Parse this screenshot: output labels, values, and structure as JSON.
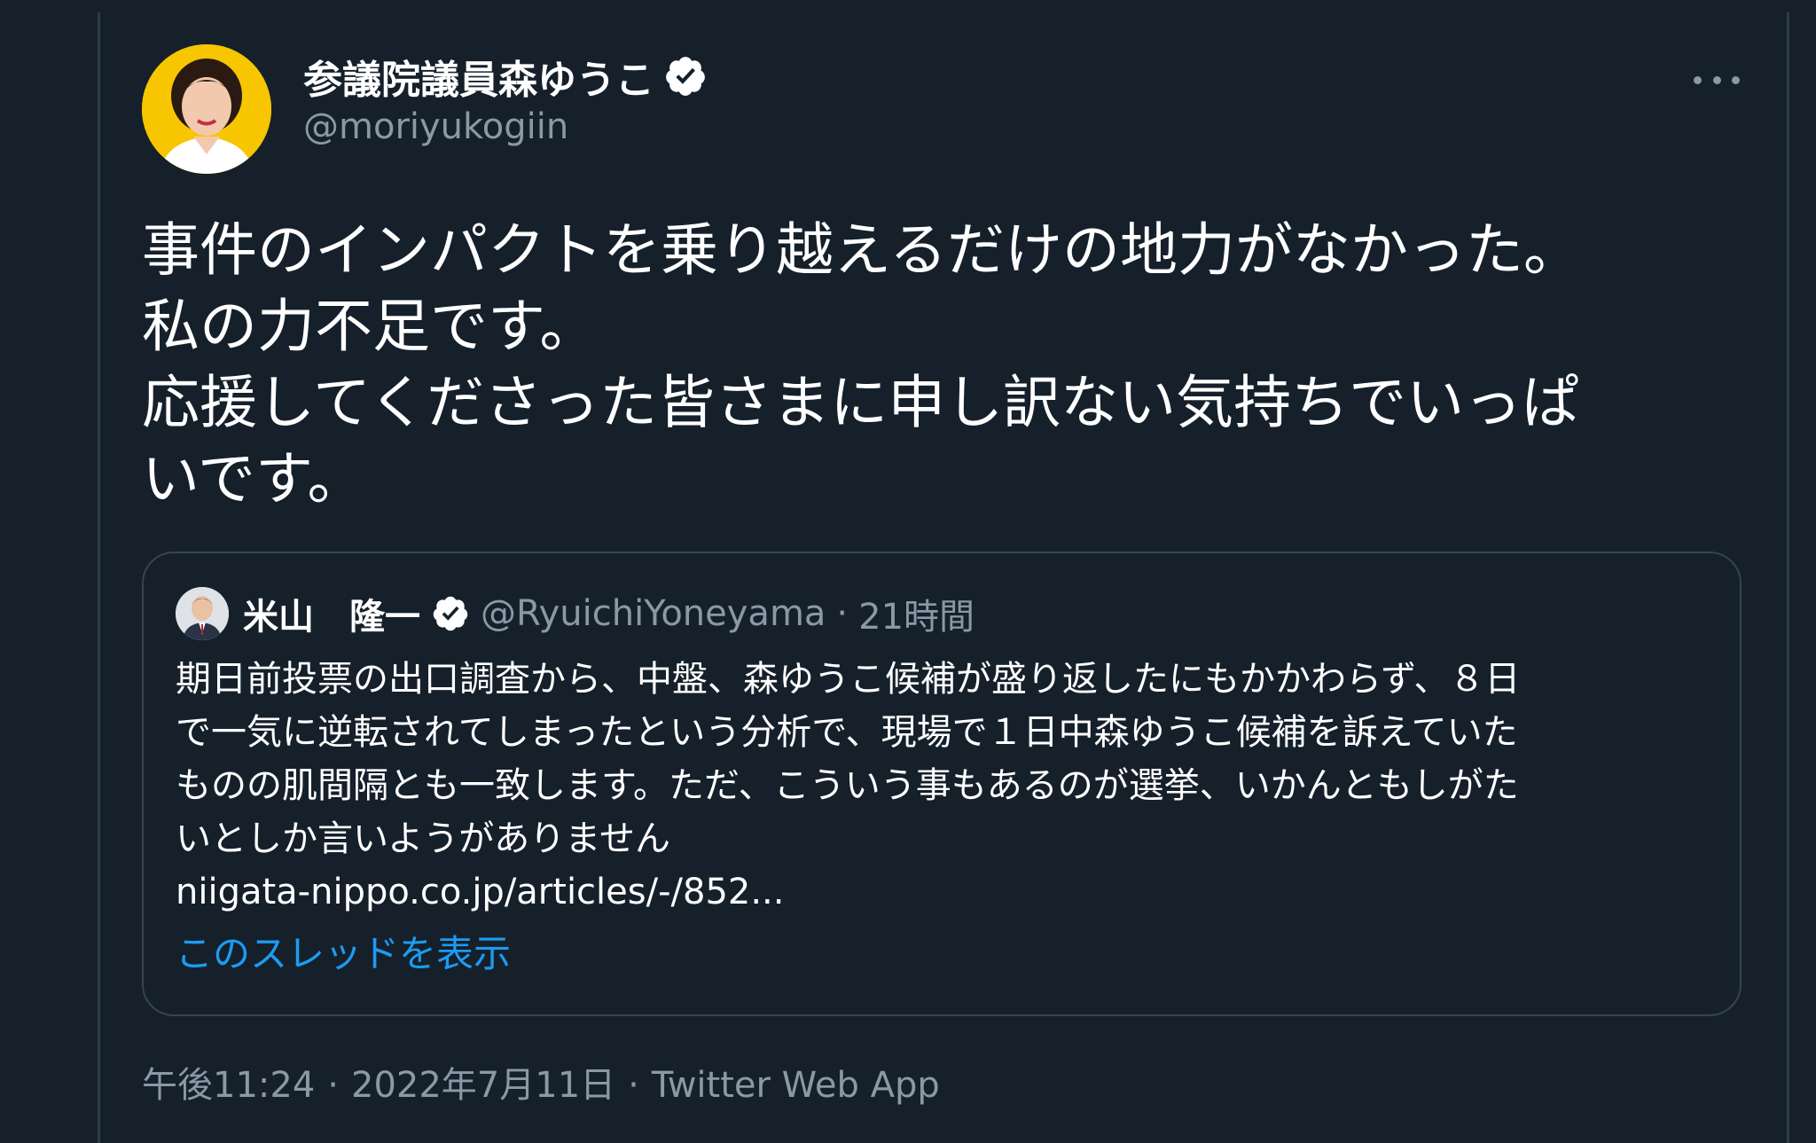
{
  "tweet": {
    "display_name": "参議院議員森ゆうこ",
    "handle": "@moriyukogiin",
    "body_lines": [
      "事件のインパクトを乗り越えるだけの地力がなかった。",
      "私の力不足です。",
      "応援してくださった皆さまに申し訳ない気持ちでいっぱ",
      "いです。"
    ],
    "time": "午後11:24",
    "date": "2022年7月11日",
    "client": "Twitter Web App",
    "separator": "·"
  },
  "quote": {
    "display_name": "米山　隆一",
    "handle": "@RyuichiYoneyama",
    "separator": "·",
    "time_ago": "21時間",
    "text_lines": [
      "期日前投票の出口調査から、中盤、森ゆうこ候補が盛り返したにもかかわらず、８日",
      "で一気に逆転されてしまったという分析で、現場で１日中森ゆうこ候補を訴えていた",
      "ものの肌間隔とも一致します。ただ、こういう事もあるのが選挙、いかんともしがた",
      "いとしか言いようがありません"
    ],
    "link": "niigata-nippo.co.jp/articles/-/852...",
    "show_thread": "このスレッドを表示"
  },
  "icons": {
    "verified": "verified-badge-icon",
    "more": "more-options-icon"
  },
  "colors": {
    "background": "#15202b",
    "accent": "#1d9bf0",
    "secondary_text": "#8b98a5",
    "border": "#38444d"
  }
}
